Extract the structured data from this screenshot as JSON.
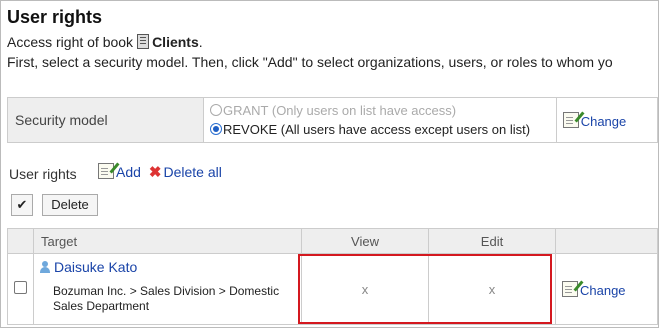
{
  "page": {
    "title": "User rights",
    "access_prefix": "Access right of book",
    "book_name": "Clients",
    "access_suffix": ".",
    "instructions": "First, select a security model. Then, click \"Add\" to select organizations, users, or roles to whom yo"
  },
  "security_model": {
    "label": "Security model",
    "option_grant": "GRANT (Only users on list have access)",
    "option_revoke": "REVOKE (All users have access except users on list)",
    "selected": "REVOKE",
    "change_label": "Change"
  },
  "user_rights": {
    "title": "User rights",
    "add_label": "Add",
    "delete_all_label": "Delete all",
    "select_all_glyph": "✔",
    "delete_label": "Delete",
    "columns": [
      "",
      "Target",
      "View",
      "Edit",
      ""
    ],
    "rows": [
      {
        "name": "Daisuke Kato",
        "org_path": "Bozuman Inc. > Sales Division > Domestic Sales Department",
        "view": "x",
        "edit": "x",
        "change_label": "Change"
      }
    ]
  },
  "colors": {
    "link": "#1a44a8",
    "highlight": "#d4181f",
    "header_bg": "#eeeeee"
  }
}
